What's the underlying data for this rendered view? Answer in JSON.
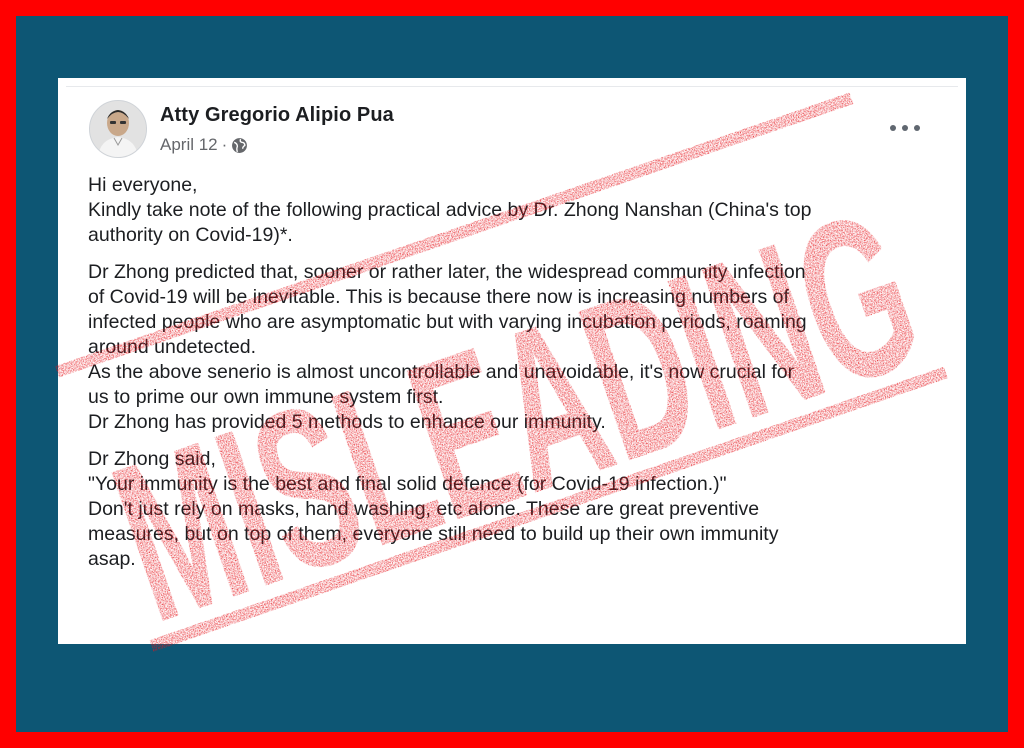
{
  "post": {
    "author": "Atty Gregorio Alipio Pua",
    "date": "April 12",
    "meta_separator": "·",
    "privacy_icon": "globe-icon",
    "more_icon": "more-options-icon",
    "paragraphs": [
      [
        "Hi everyone,",
        "Kindly take note of the following practical advice by Dr. Zhong Nanshan (China's top",
        "authority on Covid-19)*."
      ],
      [
        "Dr Zhong predicted that, sooner or rather later, the widespread community infection",
        "of Covid-19 will be inevitable. This is because there now is increasing numbers of",
        "infected people who are asymptomatic but with varying incubation periods, roaming",
        "around undetected.",
        "As the above senerio is almost uncontrollable and unavoidable, it's now crucial for",
        "us to prime our own immune system first.",
        "Dr Zhong has provided 5 methods to enhance our immunity."
      ],
      [
        "Dr Zhong said,",
        "\"Your immunity is the best and final solid defence (for Covid-19 infection.)\"",
        "Don't just rely on masks, hand washing, etc alone. These are great preventive",
        "measures, but on top of them, everyone still need to  build up their own immunity",
        "asap."
      ]
    ]
  },
  "stamp": {
    "text": "MISLEADING",
    "color": "#e5141a"
  },
  "colors": {
    "outer_border": "#ff0000",
    "background": "#0d5674",
    "card": "#ffffff",
    "name_text": "#1c1e21",
    "meta_text": "#65676b"
  }
}
